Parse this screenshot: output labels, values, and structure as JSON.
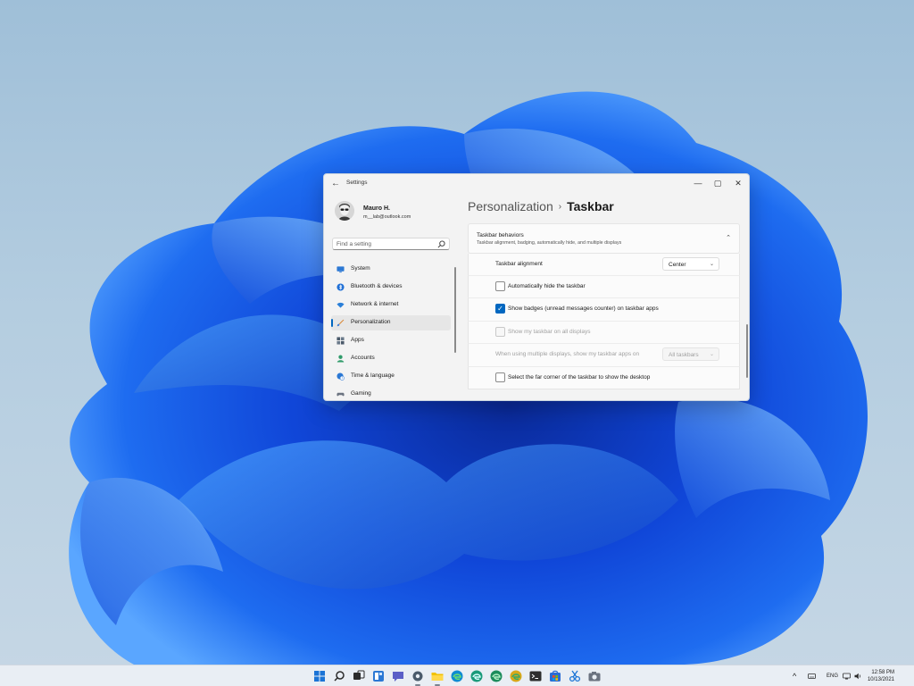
{
  "window": {
    "title": "Settings",
    "back_icon": "back-arrow-icon",
    "controls": {
      "minimize": "—",
      "maximize": "▢",
      "close": "✕"
    }
  },
  "profile": {
    "name": "Mauro H.",
    "email": "m__lab@outlook.com"
  },
  "search": {
    "placeholder": "Find a setting"
  },
  "sidebar": {
    "items": [
      {
        "label": "System",
        "icon": "monitor-icon",
        "color": "#2b78d4"
      },
      {
        "label": "Bluetooth & devices",
        "icon": "bluetooth-icon",
        "color": "#1f6fd6"
      },
      {
        "label": "Network & internet",
        "icon": "wifi-icon",
        "color": "#2a7fd8"
      },
      {
        "label": "Personalization",
        "icon": "brush-icon",
        "color": "#d9822b",
        "selected": true
      },
      {
        "label": "Apps",
        "icon": "apps-icon",
        "color": "#4a5a6a"
      },
      {
        "label": "Accounts",
        "icon": "person-icon",
        "color": "#2f9b6a"
      },
      {
        "label": "Time & language",
        "icon": "globe-clock-icon",
        "color": "#2b78d4"
      },
      {
        "label": "Gaming",
        "icon": "gamepad-icon",
        "color": "#6b7380"
      }
    ]
  },
  "breadcrumb": {
    "parent": "Personalization",
    "separator": "›",
    "current": "Taskbar"
  },
  "section": {
    "title": "Taskbar behaviors",
    "subtitle": "Taskbar alignment, badging, automatically hide, and multiple displays",
    "collapse_glyph": "⌃"
  },
  "settings": {
    "alignment": {
      "label": "Taskbar alignment",
      "value": "Center",
      "chevron": "⌄"
    },
    "auto_hide": {
      "label": "Automatically hide the taskbar",
      "checked": false
    },
    "badges": {
      "label": "Show badges (unread messages counter) on taskbar apps",
      "checked": true,
      "check_glyph": "✓"
    },
    "all_displays": {
      "label": "Show my taskbar on all displays",
      "checked": false,
      "disabled": true
    },
    "multi_display": {
      "label": "When using multiple displays, show my taskbar apps on",
      "value": "All taskbars",
      "chevron": "⌄",
      "disabled": true
    },
    "far_corner": {
      "label": "Select the far corner of the taskbar to show the desktop",
      "checked": false
    }
  },
  "taskbar": {
    "apps": [
      {
        "name": "start-icon",
        "color": "#1b74d6",
        "active": false
      },
      {
        "name": "search-icon",
        "color": "#2b2b2b",
        "active": false
      },
      {
        "name": "task-view-icon",
        "color": "#2b2b2b",
        "active": false
      },
      {
        "name": "widgets-icon",
        "color": "#2b78d4",
        "active": false
      },
      {
        "name": "chat-icon",
        "color": "#5b5fc7",
        "active": false
      },
      {
        "name": "settings-icon",
        "color": "#4a5a6a",
        "active": true
      },
      {
        "name": "file-explorer-icon",
        "color": "#f2c200",
        "active": true
      },
      {
        "name": "edge-icon",
        "color": "#0f8bd1",
        "active": false
      },
      {
        "name": "edge-beta-icon",
        "color": "#1a9a7a",
        "active": false
      },
      {
        "name": "edge-dev-icon",
        "color": "#1c8c5c",
        "active": false
      },
      {
        "name": "edge-canary-icon",
        "color": "#d8a81a",
        "active": false
      },
      {
        "name": "terminal-icon",
        "color": "#2d2d2d",
        "active": false
      },
      {
        "name": "store-icon",
        "color": "#2b6cd4",
        "active": false
      },
      {
        "name": "snipping-icon",
        "color": "#1b74d6",
        "active": false
      },
      {
        "name": "camera-icon",
        "color": "#6b7380",
        "active": false
      }
    ],
    "tray": {
      "chevron": "^",
      "language": "ENG",
      "time": "12:58 PM",
      "date": "10/13/2021"
    }
  }
}
